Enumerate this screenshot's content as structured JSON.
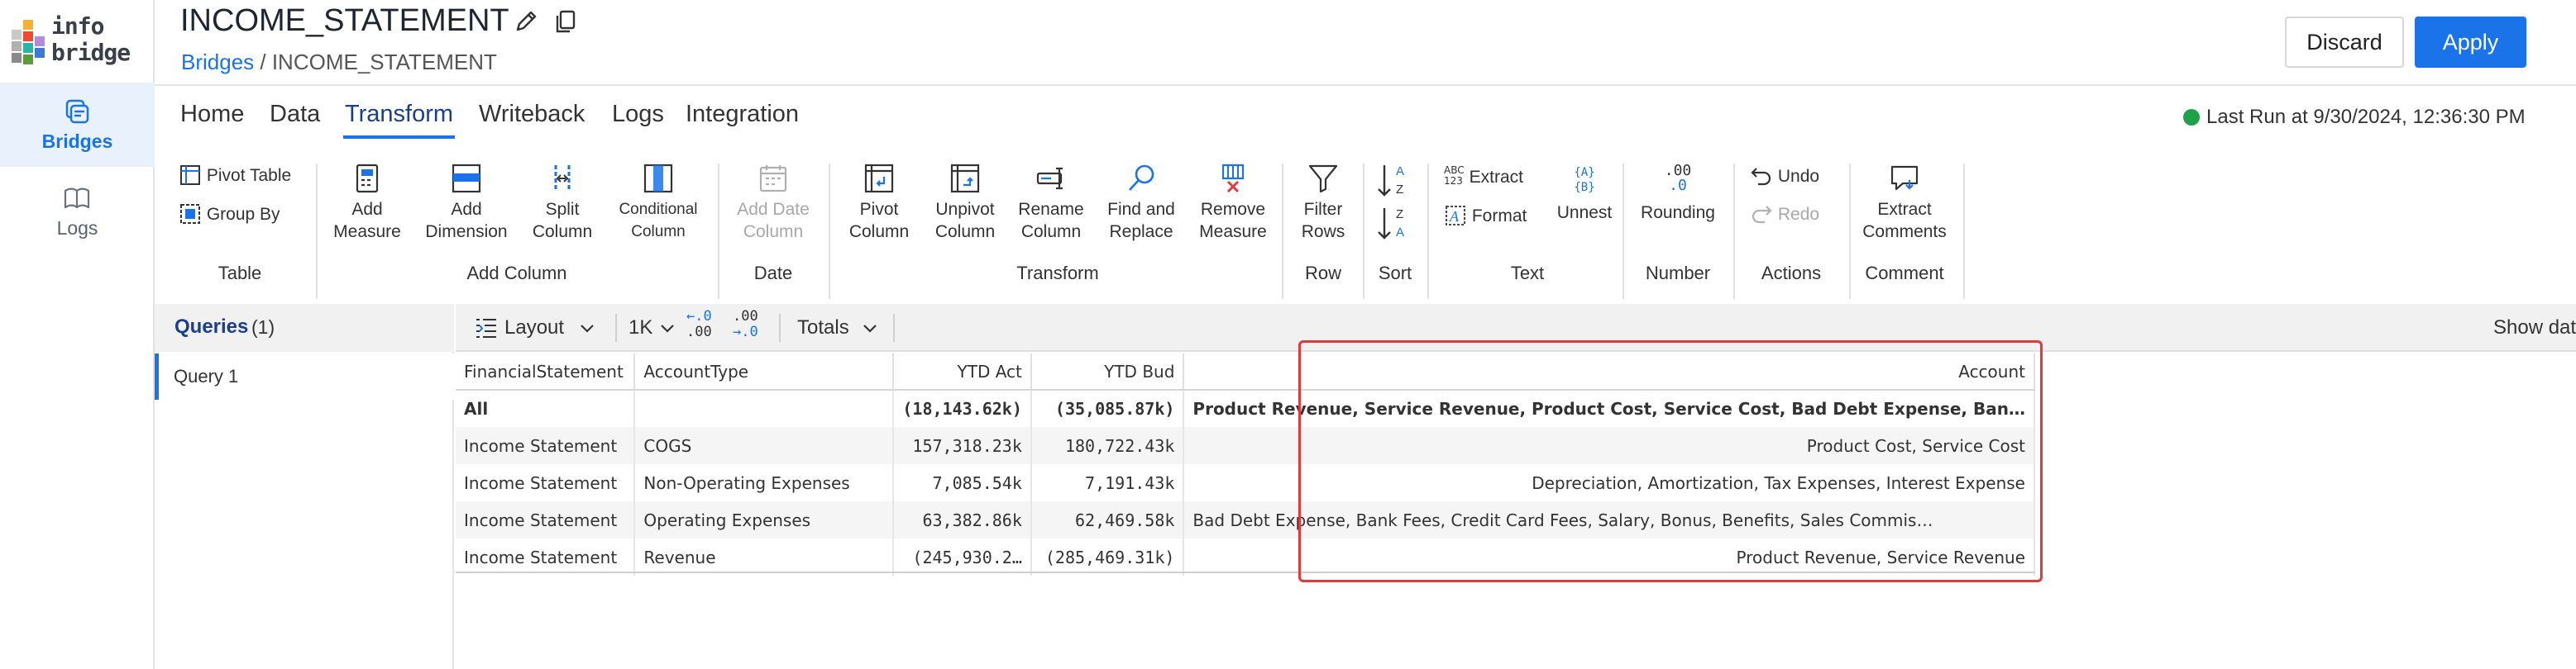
{
  "app": {
    "logo_text_line1": "info",
    "logo_text_line2": "bridge",
    "nav": [
      {
        "label": "Bridges",
        "icon": "bridge-icon",
        "active": true
      },
      {
        "label": "Logs",
        "icon": "book-icon",
        "active": false
      }
    ]
  },
  "header": {
    "title": "INCOME_STATEMENT",
    "breadcrumb_root": "Bridges",
    "breadcrumb_sep": " / ",
    "breadcrumb_current": "INCOME_STATEMENT",
    "discard_label": "Discard",
    "apply_label": "Apply"
  },
  "menu": {
    "tabs": [
      "Home",
      "Data",
      "Transform",
      "Writeback",
      "Logs",
      "Integration"
    ],
    "active_tab": "Transform",
    "last_run": "Last Run at 9/30/2024, 12:36:30 PM",
    "status_color": "#1fa04a"
  },
  "ribbon": {
    "table": {
      "pivot_table": "Pivot Table",
      "group_by": "Group By",
      "group_label": "Table"
    },
    "add_column": {
      "add_measure_1": "Add",
      "add_measure_2": "Measure",
      "add_dimension_1": "Add",
      "add_dimension_2": "Dimension",
      "split_column_1": "Split",
      "split_column_2": "Column",
      "conditional_column_1": "Conditional",
      "conditional_column_2": "Column",
      "group_label": "Add Column"
    },
    "date": {
      "add_date_column_1": "Add Date",
      "add_date_column_2": "Column",
      "group_label": "Date"
    },
    "transform": {
      "pivot_column_1": "Pivot",
      "pivot_column_2": "Column",
      "unpivot_column_1": "Unpivot",
      "unpivot_column_2": "Column",
      "rename_column_1": "Rename",
      "rename_column_2": "Column",
      "find_replace_1": "Find and",
      "find_replace_2": "Replace",
      "remove_measure_1": "Remove",
      "remove_measure_2": "Measure",
      "group_label": "Transform"
    },
    "row": {
      "filter_rows_1": "Filter",
      "filter_rows_2": "Rows",
      "group_label": "Row"
    },
    "sort": {
      "asc_top": "A",
      "asc_bottom": "Z",
      "desc_top": "Z",
      "desc_bottom": "A",
      "group_label": "Sort"
    },
    "text": {
      "extract": "Extract",
      "format": "Format",
      "unnest": "Unnest",
      "extract_icon_text_1": "ABC",
      "extract_icon_text_2": "123",
      "unnest_icon_text_1": "{A}",
      "unnest_icon_text_2": "{B}",
      "group_label": "Text"
    },
    "number": {
      "rounding": "Rounding",
      "icon_top": ".00",
      "icon_bottom": ".0",
      "group_label": "Number"
    },
    "actions": {
      "undo": "Undo",
      "redo": "Redo",
      "group_label": "Actions"
    },
    "comment": {
      "extract_comments_1": "Extract",
      "extract_comments_2": "Comments",
      "group_label": "Comment"
    }
  },
  "queries": {
    "title": "Queries",
    "count": "(1)",
    "items": [
      "Query 1"
    ]
  },
  "grid_toolbar": {
    "layout": "Layout",
    "scale": "1K",
    "dec_left_top": "←.0",
    "dec_left_bottom": ".00",
    "dec_right_top": ".00",
    "dec_right_bottom": "→.0",
    "totals": "Totals",
    "show_data": "Show dat"
  },
  "table": {
    "columns": [
      "FinancialStatement",
      "AccountType",
      "YTD Act",
      "YTD Bud",
      "Account"
    ],
    "rows": [
      {
        "fs": "All",
        "type": "",
        "act": "(18,143.62k)",
        "bud": "(35,085.87k)",
        "acct": "Product Revenue, Service Revenue, Product Cost, Service Cost, Bad Debt Expense, Ban…"
      },
      {
        "fs": "Income Statement",
        "type": "COGS",
        "act": "157,318.23k",
        "bud": "180,722.43k",
        "acct": "Product Cost, Service Cost"
      },
      {
        "fs": "Income Statement",
        "type": "Non-Operating Expenses",
        "act": "7,085.54k",
        "bud": "7,191.43k",
        "acct": "Depreciation, Amortization, Tax Expenses, Interest Expense"
      },
      {
        "fs": "Income Statement",
        "type": "Operating Expenses",
        "act": "63,382.86k",
        "bud": "62,469.58k",
        "acct": "Bad Debt Expense, Bank Fees, Credit Card Fees, Salary, Bonus, Benefits, Sales Commis…"
      },
      {
        "fs": "Income Statement",
        "type": "Revenue",
        "act": "(245,930.2…",
        "bud": "(285,469.31k)",
        "acct": "Product Revenue, Service Revenue"
      }
    ]
  }
}
